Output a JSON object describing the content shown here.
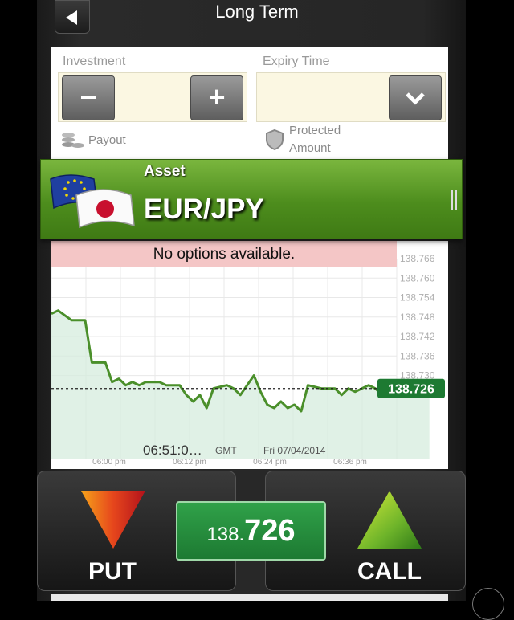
{
  "header": {
    "title": "Long Term"
  },
  "form": {
    "investment_label": "Investment",
    "expiry_label": "Expiry Time",
    "minus": "−",
    "plus": "+",
    "payout_label": "Payout",
    "protected_line1": "Protected",
    "protected_line2": "Amount"
  },
  "asset": {
    "label": "Asset",
    "name": "EUR/JPY"
  },
  "notice": "No options available.",
  "trade": {
    "put": "PUT",
    "call": "CALL",
    "price_prefix": "138.",
    "price_main": "726"
  },
  "colors": {
    "accent_green": "#4d8d1d",
    "price_green": "#1d7a32",
    "notice_pink": "#f4c6c6"
  },
  "chart_data": {
    "type": "area",
    "ylim": [
      138.72,
      138.766
    ],
    "y_ticks": [
      "138.766",
      "138.760",
      "138.754",
      "138.748",
      "138.742",
      "138.736",
      "138.730"
    ],
    "x_ticks": [
      "06:00 pm",
      "06:12 pm",
      "06:24 pm",
      "06:36 pm"
    ],
    "x_range_minutes": [
      -2,
      42
    ],
    "current_value": 138.726,
    "current_label": "138.726",
    "time_label": "06:51:0…",
    "tz_label": "GMT",
    "date_label": "Fri 07/04/2014",
    "series": [
      {
        "values": [
          [
            -2,
            138.749
          ],
          [
            -1,
            138.75
          ],
          [
            1,
            138.747
          ],
          [
            3,
            138.747
          ],
          [
            4,
            138.734
          ],
          [
            6,
            138.734
          ],
          [
            7,
            138.728
          ],
          [
            8,
            138.729
          ],
          [
            9,
            138.727
          ],
          [
            10,
            138.728
          ],
          [
            11,
            138.727
          ],
          [
            12,
            138.728
          ],
          [
            14,
            138.728
          ],
          [
            15,
            138.727
          ],
          [
            17,
            138.727
          ],
          [
            18,
            138.724
          ],
          [
            19,
            138.722
          ],
          [
            20,
            138.724
          ],
          [
            21,
            138.72
          ],
          [
            22,
            138.726
          ],
          [
            24,
            138.727
          ],
          [
            25,
            138.726
          ],
          [
            26,
            138.724
          ],
          [
            27,
            138.727
          ],
          [
            28,
            138.73
          ],
          [
            29,
            138.725
          ],
          [
            30,
            138.721
          ],
          [
            31,
            138.72
          ],
          [
            32,
            138.722
          ],
          [
            33,
            138.72
          ],
          [
            34,
            138.721
          ],
          [
            35,
            138.719
          ],
          [
            36,
            138.727
          ],
          [
            38,
            138.726
          ],
          [
            40,
            138.726
          ],
          [
            41,
            138.724
          ],
          [
            42,
            138.726
          ],
          [
            43,
            138.725
          ],
          [
            44,
            138.726
          ],
          [
            45,
            138.727
          ],
          [
            46,
            138.726
          ],
          [
            47,
            138.724
          ],
          [
            49,
            138.724
          ],
          [
            51,
            138.724
          ],
          [
            52,
            138.727
          ],
          [
            53,
            138.726
          ],
          [
            54,
            138.726
          ]
        ]
      }
    ]
  }
}
